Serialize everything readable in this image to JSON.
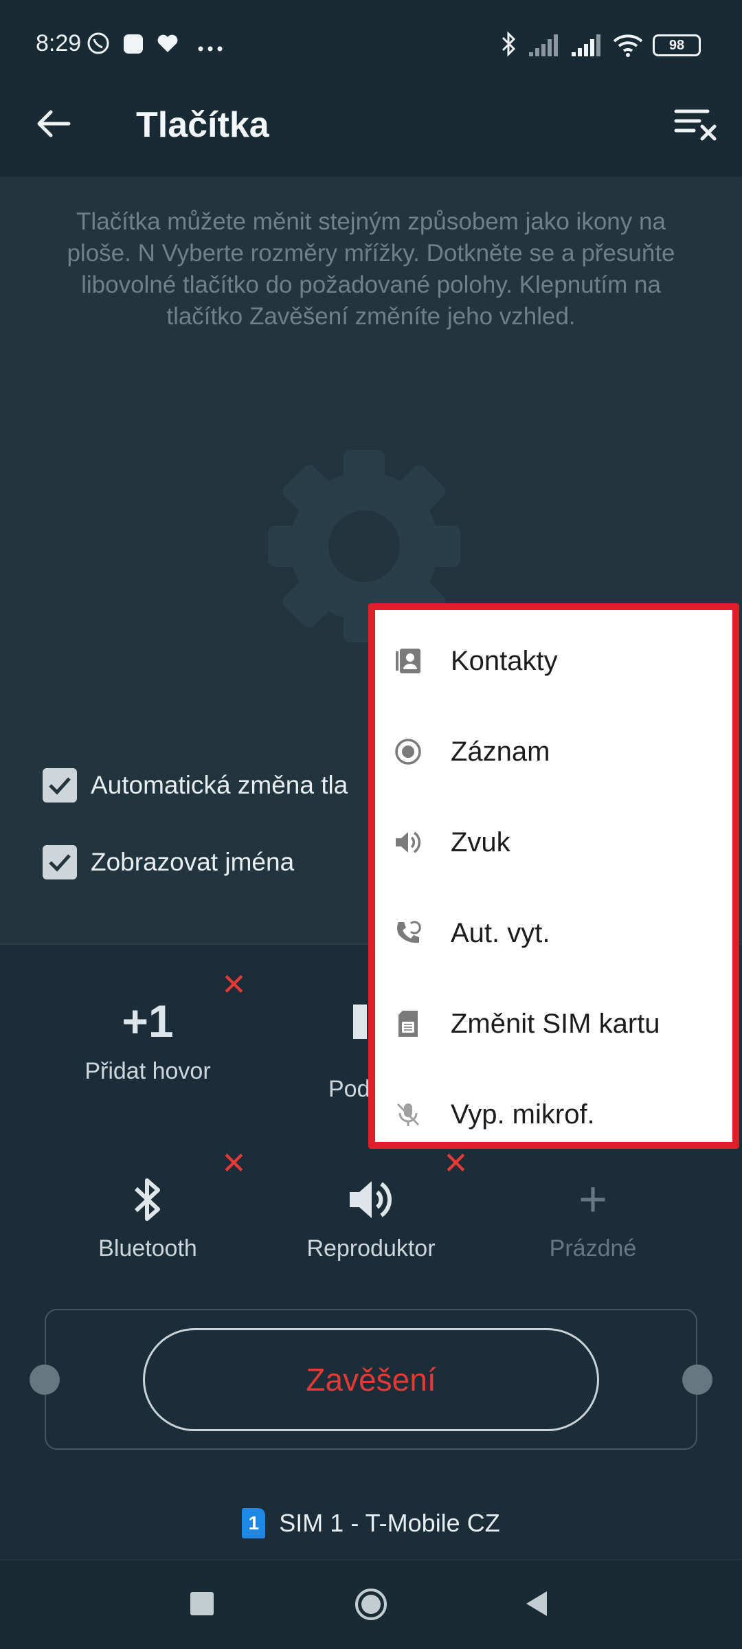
{
  "status_bar": {
    "time": "8:29",
    "battery": "98"
  },
  "app_bar": {
    "title": "Tlačítka"
  },
  "description": "Tlačítka můžete měnit stejným způsobem jako ikony na ploše.  N Vyberte rozměry mřížky. Dotkněte se a přesuňte libovolné tlačítko do požadované polohy. Klepnutím na tlačítko Zavěšení změníte jeho vzhled.",
  "checkboxes": [
    {
      "label": "Automatická změna tla",
      "checked": true
    },
    {
      "label": "Zobrazovat jména",
      "checked": true
    }
  ],
  "grid": {
    "add_call": {
      "glyph": "+1",
      "label": "Přidat hovor"
    },
    "hold": {
      "label": "Pod"
    },
    "bluetooth": {
      "label": "Bluetooth"
    },
    "speaker": {
      "label": "Reproduktor"
    },
    "empty": {
      "glyph": "+",
      "label": "Prázdné"
    }
  },
  "hangup": {
    "label": "Zavěšení"
  },
  "sim": {
    "number": "1",
    "label": "SIM 1 - T-Mobile CZ"
  },
  "menu": {
    "items": [
      {
        "label": "Kontakty",
        "icon": "contacts-icon"
      },
      {
        "label": "Záznam",
        "icon": "record-icon"
      },
      {
        "label": "Zvuk",
        "icon": "speaker-icon"
      },
      {
        "label": "Aut. vyt.",
        "icon": "auto-redial-icon"
      },
      {
        "label": "Změnit SIM kartu",
        "icon": "sim-card-icon"
      },
      {
        "label": "Vyp. mikrof.",
        "icon": "mic-off-icon"
      }
    ]
  },
  "colors": {
    "accent_red": "#e53935",
    "background": "#1b2d38",
    "popup_border": "#e01e2a"
  }
}
